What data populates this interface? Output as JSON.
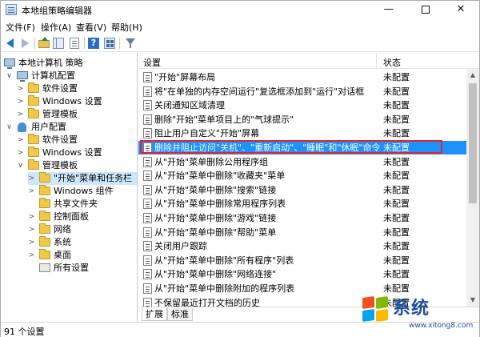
{
  "window": {
    "title": "本地组策略编辑器"
  },
  "menu": [
    "文件(F)",
    "操作(A)",
    "查看(V)",
    "帮助(H)"
  ],
  "toolbar": {
    "icons": [
      "back-icon",
      "forward-icon",
      "up-folder-icon",
      "show-hide-tree-icon",
      "export-list-icon",
      "help-icon",
      "properties-icon",
      "filter-icon"
    ]
  },
  "tree": {
    "items": [
      {
        "label": "本地计算机 策略",
        "icon": "computer-icon",
        "expander": ""
      },
      {
        "label": "计算机配置",
        "icon": "computer-icon",
        "expander": "∨"
      },
      {
        "label": "软件设置",
        "icon": "folder-icon",
        "expander": ">"
      },
      {
        "label": "Windows 设置",
        "icon": "folder-icon",
        "expander": ">"
      },
      {
        "label": "管理模板",
        "icon": "folder-icon",
        "expander": ">"
      },
      {
        "label": "用户配置",
        "icon": "user-icon",
        "expander": "∨"
      },
      {
        "label": "软件设置",
        "icon": "folder-icon",
        "expander": ">"
      },
      {
        "label": "Windows 设置",
        "icon": "folder-icon",
        "expander": ">"
      },
      {
        "label": "管理模板",
        "icon": "folder-icon",
        "expander": "∨"
      },
      {
        "label": "\"开始\"菜单和任务栏",
        "icon": "folder-icon",
        "expander": ">"
      },
      {
        "label": "Windows 组件",
        "icon": "folder-icon",
        "expander": ">"
      },
      {
        "label": "共享文件夹",
        "icon": "folder-icon",
        "expander": ""
      },
      {
        "label": "控制面板",
        "icon": "folder-icon",
        "expander": ">"
      },
      {
        "label": "网络",
        "icon": "folder-icon",
        "expander": ">"
      },
      {
        "label": "系统",
        "icon": "folder-icon",
        "expander": ">"
      },
      {
        "label": "桌面",
        "icon": "folder-icon",
        "expander": ">"
      },
      {
        "label": "所有设置",
        "icon": "settings-icon",
        "expander": ""
      }
    ]
  },
  "list": {
    "columns": {
      "setting": "设置",
      "state": "状态"
    },
    "rows": [
      {
        "name": "\"开始\"屏幕布局",
        "state": "未配置"
      },
      {
        "name": "将\"在单独的内存空间运行\"复选框添加到\"运行\"对话框",
        "state": "未配置"
      },
      {
        "name": "关闭通知区域清理",
        "state": "未配置"
      },
      {
        "name": "删除\"开始\"菜单项目上的\"气球提示\"",
        "state": "未配置"
      },
      {
        "name": "阻止用户自定义\"开始\"屏幕",
        "state": "未配置"
      },
      {
        "name": "删除并阻止访问\"关机\"、\"重新启动\"、\"睡眠\"和\"休眠\"命令",
        "state": "未配置"
      },
      {
        "name": "从\"开始\"菜单删除公用程序组",
        "state": "未配置"
      },
      {
        "name": "从\"开始\"菜单中删除\"收藏夹\"菜单",
        "state": "未配置"
      },
      {
        "name": "从\"开始\"菜单中删除\"搜索\"链接",
        "state": "未配置"
      },
      {
        "name": "从\"开始\"菜单中删除常用程序列表",
        "state": "未配置"
      },
      {
        "name": "从\"开始\"菜单中删除\"游戏\"链接",
        "state": "未配置"
      },
      {
        "name": "从\"开始\"菜单中删除\"帮助\"菜单",
        "state": "未配置"
      },
      {
        "name": "关闭用户跟踪",
        "state": "未配置"
      },
      {
        "name": "从\"开始\"菜单中删除\"所有程序\"列表",
        "state": "未配置"
      },
      {
        "name": "从\"开始\"菜单中删除\"网络连接\"",
        "state": "未配置"
      },
      {
        "name": "从\"开始\"菜单中删除附加的程序列表",
        "state": "未配置"
      },
      {
        "name": "不保留最近打开文档的历史",
        "state": "未配置"
      }
    ]
  },
  "tabs": [
    "扩展",
    "标准"
  ],
  "status": {
    "text": "91 个设置"
  },
  "watermark": {
    "brand": "系统",
    "url": "www.xitong8.com"
  },
  "colors": {
    "selection": "#1e90ff",
    "highlight_box": "#e3262e",
    "tree_selection": "#cce8ff"
  }
}
